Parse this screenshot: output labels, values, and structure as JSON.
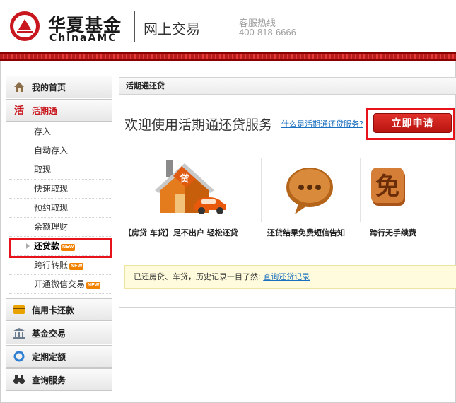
{
  "header": {
    "brand_cn": "华夏基金",
    "brand_en": "ChinaAMC",
    "site_title": "网上交易",
    "hotline_label": "客服热线",
    "hotline_number": "400-818-6666"
  },
  "sidebar": {
    "home": "我的首页",
    "current_product": "活期通",
    "sub_items": [
      {
        "label": "存入",
        "new": false
      },
      {
        "label": "自动存入",
        "new": false
      },
      {
        "label": "取现",
        "new": false
      },
      {
        "label": "快速取现",
        "new": false
      },
      {
        "label": "预约取现",
        "new": false
      },
      {
        "label": "余额理财",
        "new": false
      },
      {
        "label": "还贷款",
        "new": true
      },
      {
        "label": "跨行转账",
        "new": true
      },
      {
        "label": "开通微信交易",
        "new": true
      }
    ],
    "new_badge": "NEW",
    "bottom_items": [
      "信用卡还款",
      "基金交易",
      "定期定额",
      "查询服务"
    ]
  },
  "main": {
    "panel_title": "活期通还贷",
    "welcome": "欢迎使用活期通还贷服务",
    "what_link": "什么是活期通还贷服务?",
    "apply_button": "立即申请",
    "features": [
      {
        "caption": "【房贷 车贷】足不出户 轻松还贷",
        "icon": "house-car-loan-icon",
        "badge": "贷"
      },
      {
        "caption": "还贷结果免费短信告知",
        "icon": "chat-bubble-icon"
      },
      {
        "caption": "跨行无手续费",
        "icon": "free-icon",
        "badge": "免"
      }
    ],
    "notice_text": "已还房贷、车贷，历史记录一目了然:",
    "notice_link": "查询还贷记录"
  },
  "colors": {
    "brand_red": "#c8171e",
    "highlight_red": "#e8121a",
    "link_blue": "#1b6fbf",
    "badge_orange": "#f08200"
  }
}
